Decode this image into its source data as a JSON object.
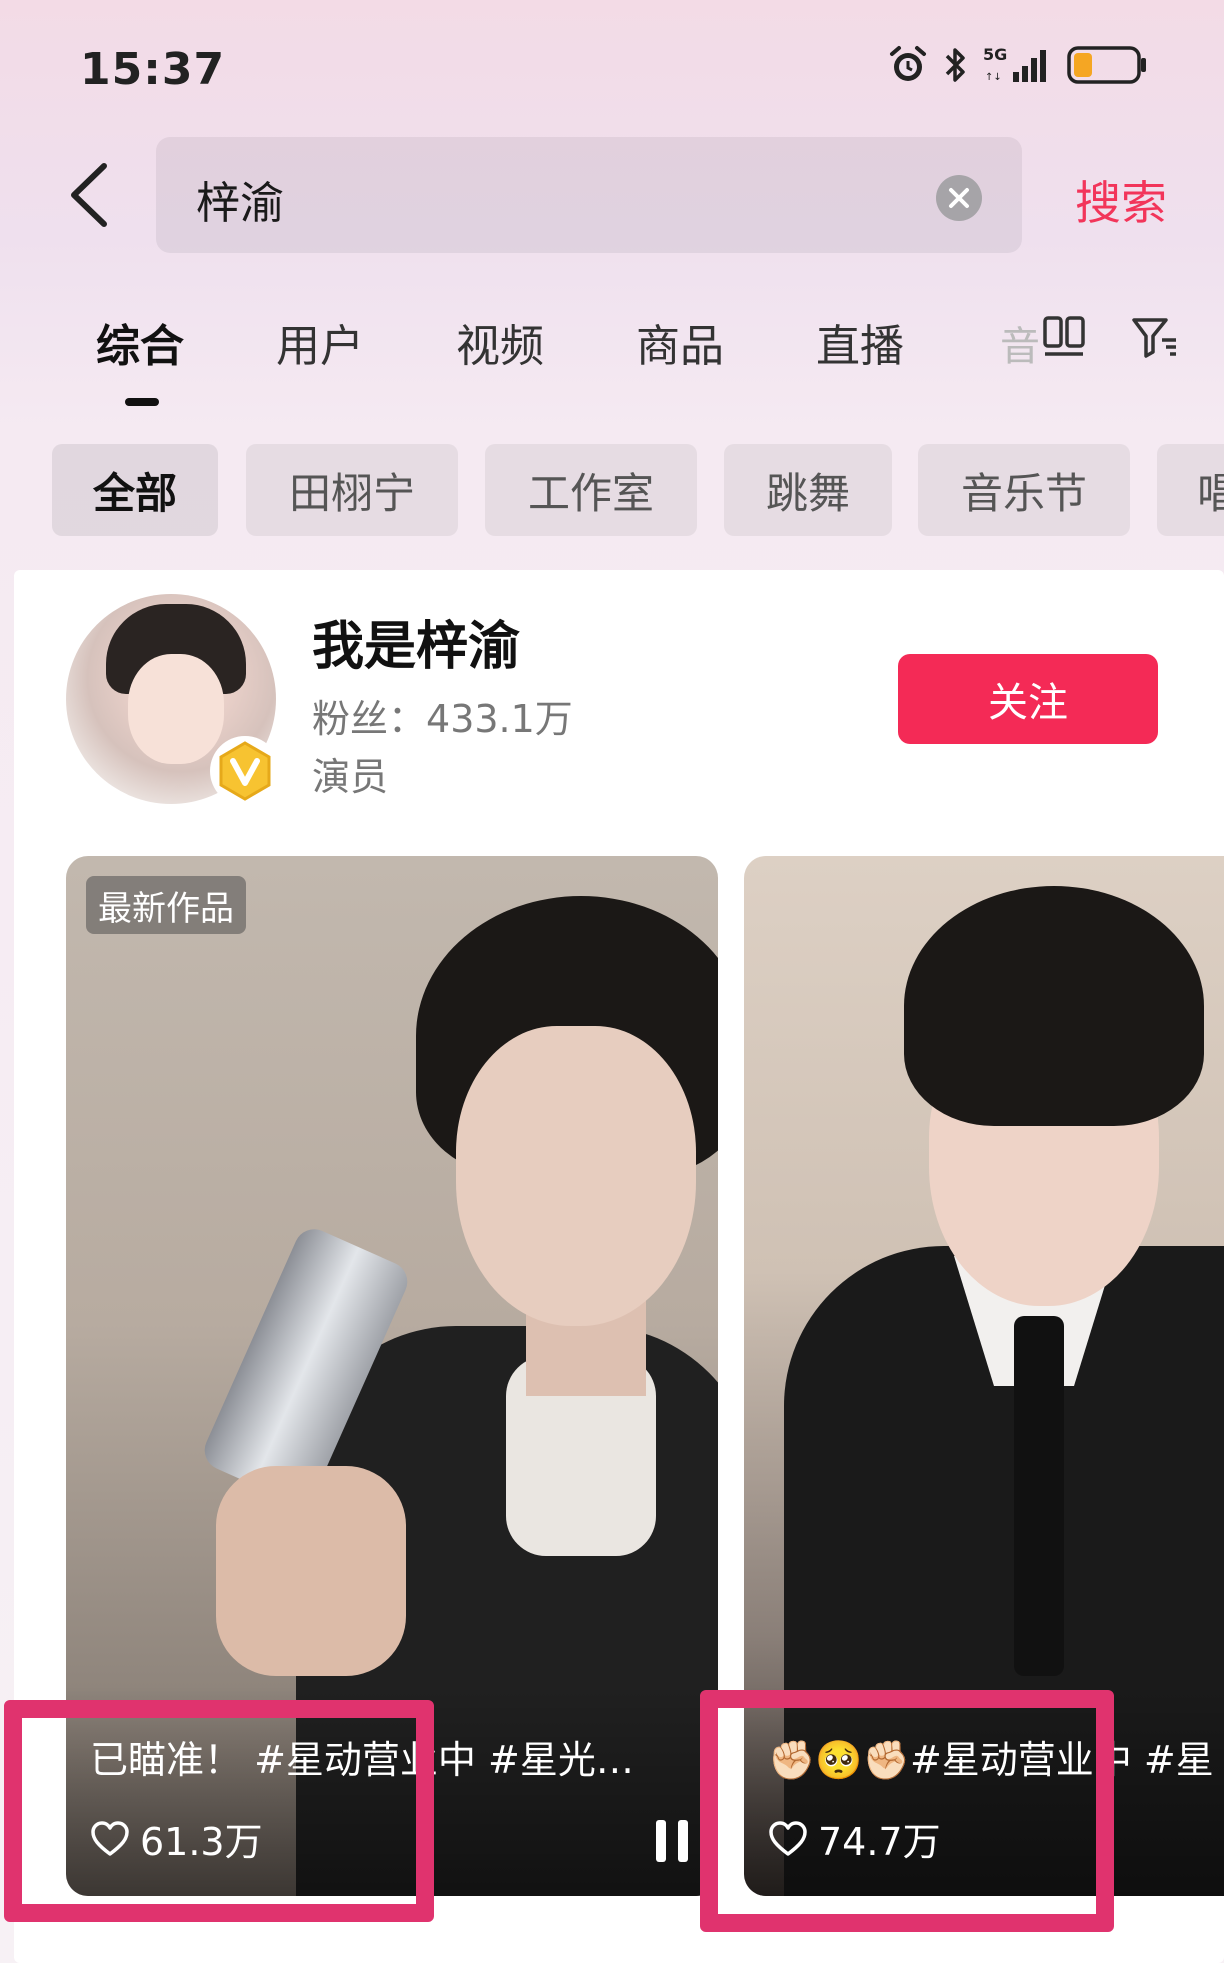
{
  "status_bar": {
    "time": "15:37",
    "network": "5G",
    "icons": [
      "alarm-icon",
      "bluetooth-icon",
      "signal-icon",
      "battery-low-icon"
    ],
    "battery_color": "#f5a623"
  },
  "search": {
    "query": "梓渝",
    "submit_label": "搜索",
    "accent": "#f2355a"
  },
  "tabs": [
    {
      "label": "综合",
      "active": true
    },
    {
      "label": "用户",
      "active": false
    },
    {
      "label": "视频",
      "active": false
    },
    {
      "label": "商品",
      "active": false
    },
    {
      "label": "直播",
      "active": false
    },
    {
      "label": "音",
      "active": false
    }
  ],
  "filter_chips": [
    {
      "label": "全部",
      "active": true
    },
    {
      "label": "田栩宁",
      "active": false
    },
    {
      "label": "工作室",
      "active": false
    },
    {
      "label": "跳舞",
      "active": false
    },
    {
      "label": "音乐节",
      "active": false
    },
    {
      "label": "唱",
      "active": false
    }
  ],
  "user_card": {
    "name": "我是梓渝",
    "fans_label": "粉丝：",
    "fans_value": "433.1万",
    "occupation": "演员",
    "verified": true,
    "follow_label": "关注",
    "follow_color": "#f42a56"
  },
  "videos": [
    {
      "badge": "最新作品",
      "caption": "已瞄准！ #星动营业中 #星光…",
      "likes": "61.3万",
      "playing": true
    },
    {
      "badge": "",
      "caption": "✊🏻🥺✊🏻#星动营业中 #星",
      "likes": "74.7万",
      "playing": false
    }
  ],
  "annotation_color": "#e0336e"
}
